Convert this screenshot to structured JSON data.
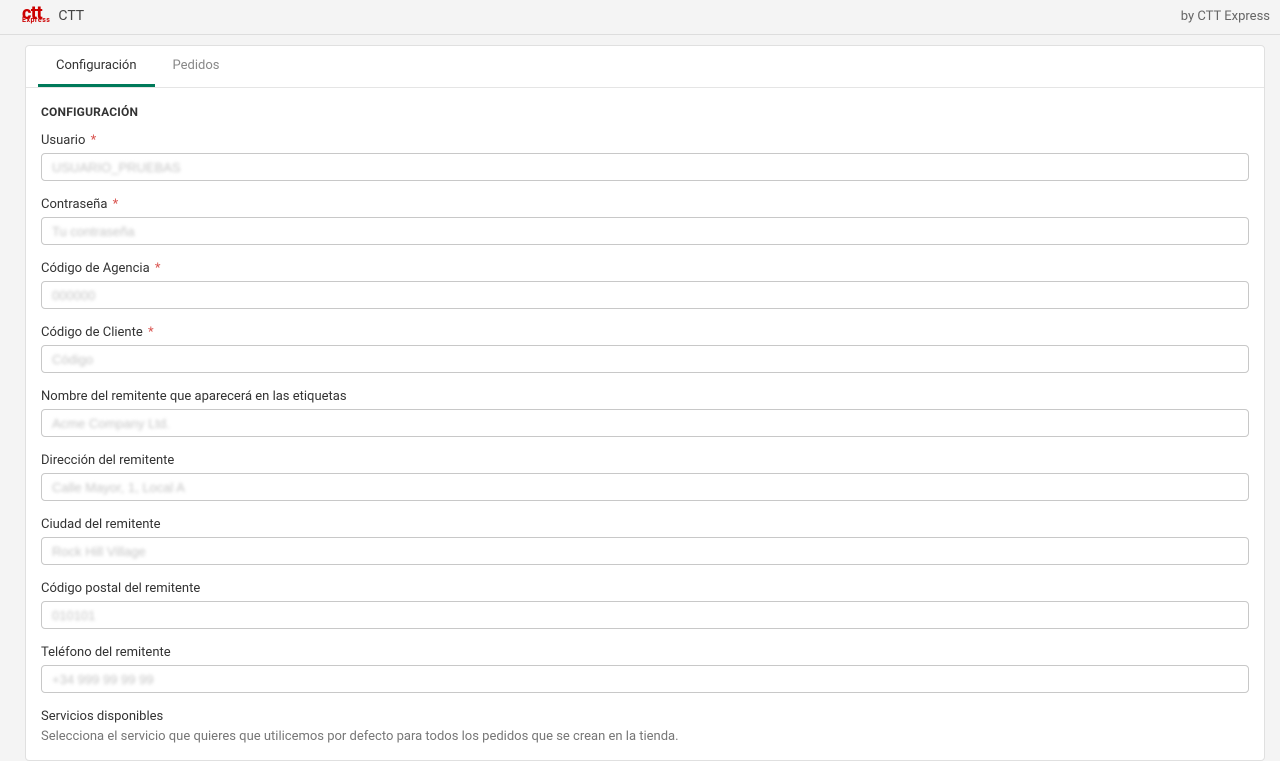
{
  "topbar": {
    "logo_line1": "ctt",
    "logo_line2": "Express",
    "app_title": "CTT",
    "byline": "by CTT Express"
  },
  "tabs": [
    {
      "id": "config",
      "label": "Configuración",
      "active": true
    },
    {
      "id": "pedidos",
      "label": "Pedidos",
      "active": false
    }
  ],
  "section_title": "CONFIGURACIÓN",
  "fields": {
    "usuario": {
      "label": "Usuario",
      "required": true,
      "placeholder": "USUARIO_PRUEBAS",
      "value": ""
    },
    "contrasena": {
      "label": "Contraseña",
      "required": true,
      "placeholder": "Tu contraseña",
      "value": ""
    },
    "codigo_agencia": {
      "label": "Código de Agencia",
      "required": true,
      "placeholder": "000000",
      "value": ""
    },
    "codigo_cliente": {
      "label": "Código de Cliente",
      "required": true,
      "placeholder": "Código",
      "value": ""
    },
    "nombre_remitente": {
      "label": "Nombre del remitente que aparecerá en las etiquetas",
      "required": false,
      "placeholder": "Acme Company Ltd.",
      "value": ""
    },
    "direccion": {
      "label": "Dirección del remitente",
      "required": false,
      "placeholder": "Calle Mayor, 1, Local A",
      "value": ""
    },
    "ciudad": {
      "label": "Ciudad del remitente",
      "required": false,
      "placeholder": "Rock Hill Village",
      "value": ""
    },
    "cp": {
      "label": "Código postal del remitente",
      "required": false,
      "placeholder": "010101",
      "value": ""
    },
    "telefono": {
      "label": "Teléfono del remitente",
      "required": false,
      "placeholder": "+34 999 99 99 99",
      "value": ""
    }
  },
  "servicios": {
    "label": "Servicios disponibles",
    "hint": "Selecciona el servicio que quieres que utilicemos por defecto para todos los pedidos que se crean en la tienda."
  },
  "required_star": "*"
}
